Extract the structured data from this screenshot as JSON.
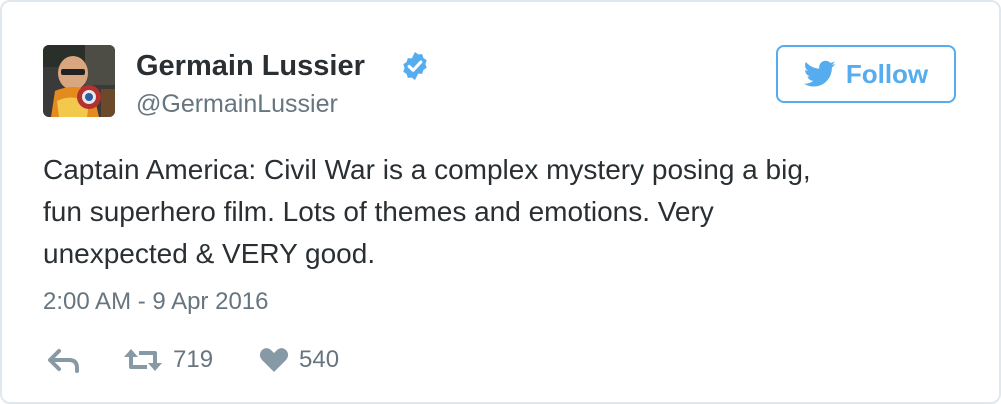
{
  "author": {
    "name": "Germain Lussier",
    "handle": "@GermainLussier",
    "verified": true
  },
  "follow_button": {
    "label": "Follow"
  },
  "tweet": {
    "text": "Captain America: Civil War is a complex mystery posing a big,\nfun superhero film. Lots of themes and emotions. Very\nunexpected & VERY good.",
    "timestamp": "2:00 AM - 9 Apr 2016"
  },
  "actions": {
    "reply_icon": "reply-icon",
    "retweet_icon": "retweet-icon",
    "like_icon": "heart-icon",
    "retweets": "719",
    "likes": "540"
  },
  "colors": {
    "accent": "#55acee",
    "text": "#292f33",
    "muted": "#66757f",
    "icon": "#8899a6",
    "border": "#e1e8ed"
  }
}
